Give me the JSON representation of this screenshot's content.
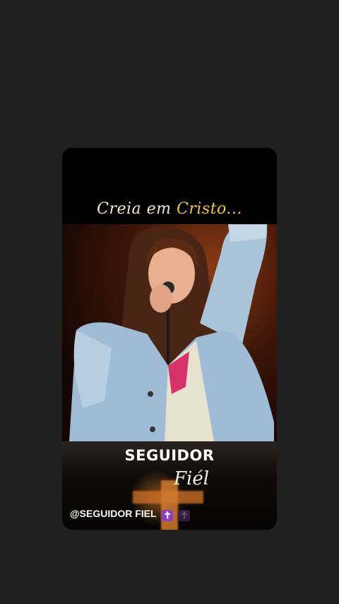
{
  "story": {
    "overlay_text_part1": "Creia em ",
    "overlay_text_part2": "Cristo...",
    "brand_big": "SEGUIDOR",
    "brand_script": "Fiél",
    "handle": "@SEGUIDOR FIEL",
    "handle_emoji": "✝",
    "accent_color": "#f0c44a",
    "image_description_icon": "singer-photo"
  }
}
